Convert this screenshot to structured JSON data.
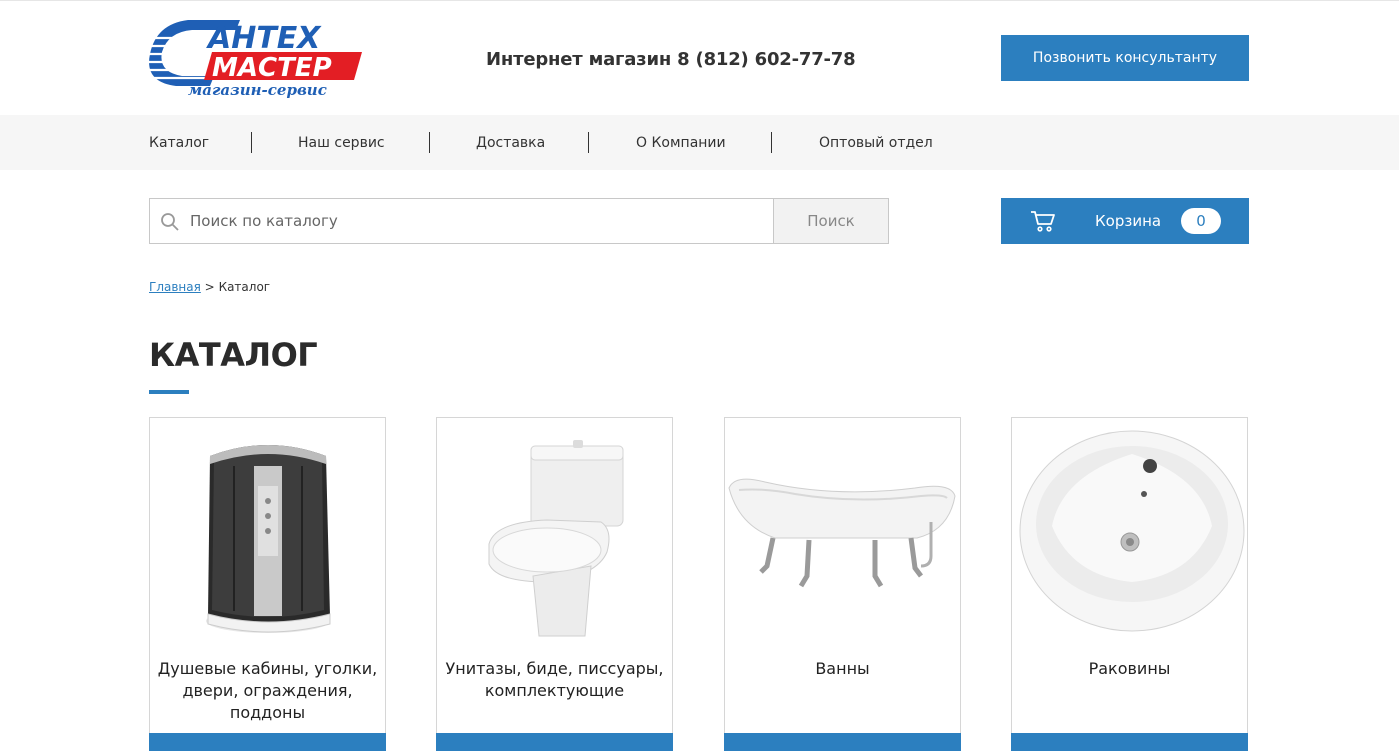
{
  "header": {
    "logo_line1": "АНТЕХ",
    "logo_line2": "МАСТЕР",
    "logo_tagline": "магазин-сервис",
    "phone": "Интернет магазин 8 (812) 602-77-78",
    "call_button": "Позвонить консультанту"
  },
  "nav": {
    "items": [
      {
        "label": "Каталог"
      },
      {
        "label": "Наш сервис"
      },
      {
        "label": "Доставка"
      },
      {
        "label": "О Компании"
      },
      {
        "label": "Оптовый отдел"
      }
    ]
  },
  "search": {
    "placeholder": "Поиск по каталогу",
    "button": "Поиск"
  },
  "cart": {
    "label": "Корзина",
    "count": "0"
  },
  "breadcrumb": {
    "home": "Главная",
    "separator": ">",
    "current": "Каталог"
  },
  "page": {
    "title": "КАТАЛОГ"
  },
  "catalog": {
    "items": [
      {
        "title": "Душевые кабины, уголки, двери, ограждения, поддоны",
        "icon": "shower-cabin-image"
      },
      {
        "title": "Унитазы, биде, писсуары, комплектующие",
        "icon": "toilet-image"
      },
      {
        "title": "Ванны",
        "icon": "bathtub-image"
      },
      {
        "title": "Раковины",
        "icon": "sink-image"
      }
    ]
  },
  "colors": {
    "accent": "#2c7fbf",
    "logo_red": "#e31e24",
    "logo_blue": "#1f5fb5"
  }
}
